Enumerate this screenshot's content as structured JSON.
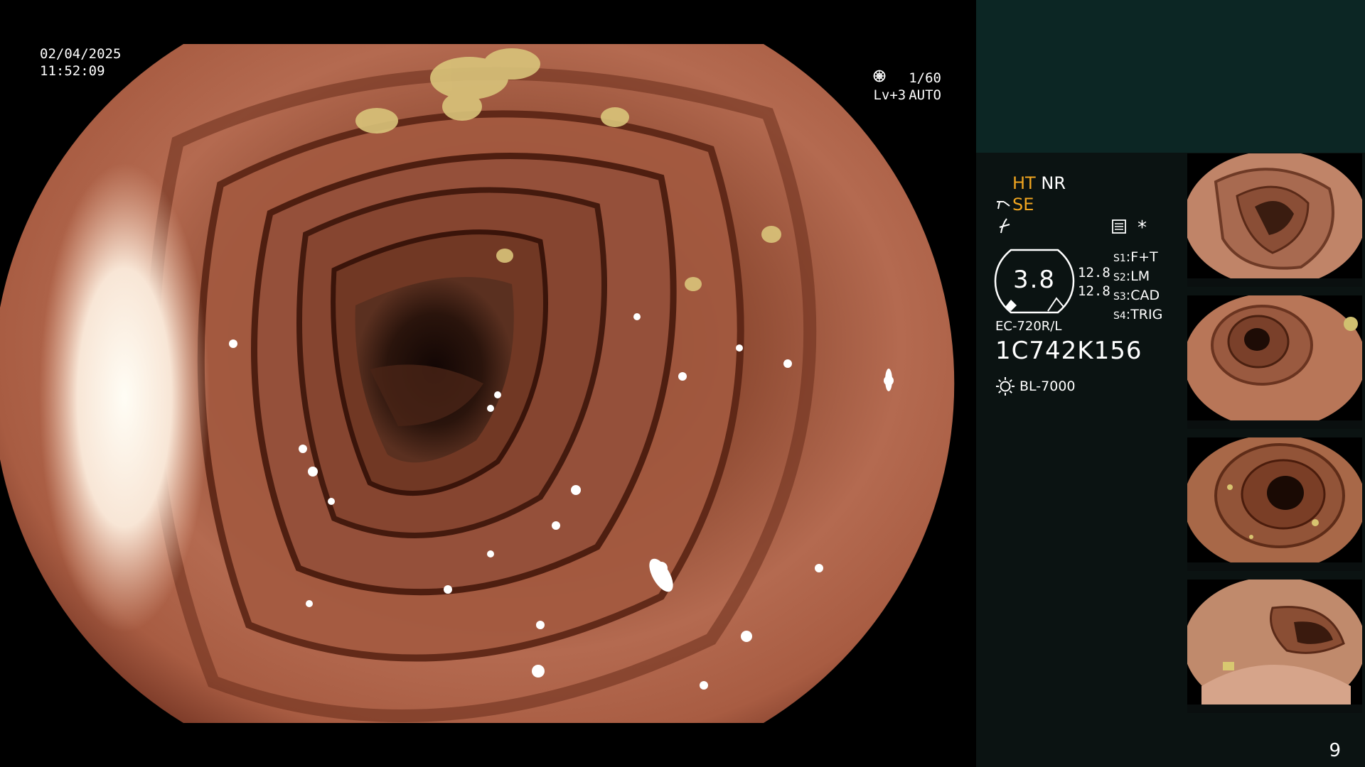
{
  "osd": {
    "date": "02/04/2025",
    "time": "11:52:09",
    "shutter": "1/60",
    "level": "Lv+3",
    "mode": "AUTO"
  },
  "modes": {
    "ht": "HT",
    "nr": "NR",
    "se": "SE"
  },
  "enhance": {
    "value": "3.8",
    "val_a": "12.8",
    "val_b": "12.8"
  },
  "switches": [
    {
      "key": "S1",
      "value": "F+T"
    },
    {
      "key": "S2",
      "value": "LM"
    },
    {
      "key": "S3",
      "value": "CAD"
    },
    {
      "key": "S4",
      "value": "TRIG"
    }
  ],
  "scope": {
    "model": "EC-720R/L",
    "serial": "1C742K156",
    "light_source": "BL-7000",
    "asterisk": "*"
  },
  "page_number": "9",
  "colors": {
    "accent_orange": "#f0a520",
    "panel_dark": "#0b1312",
    "panel_teal": "#0c2624"
  }
}
